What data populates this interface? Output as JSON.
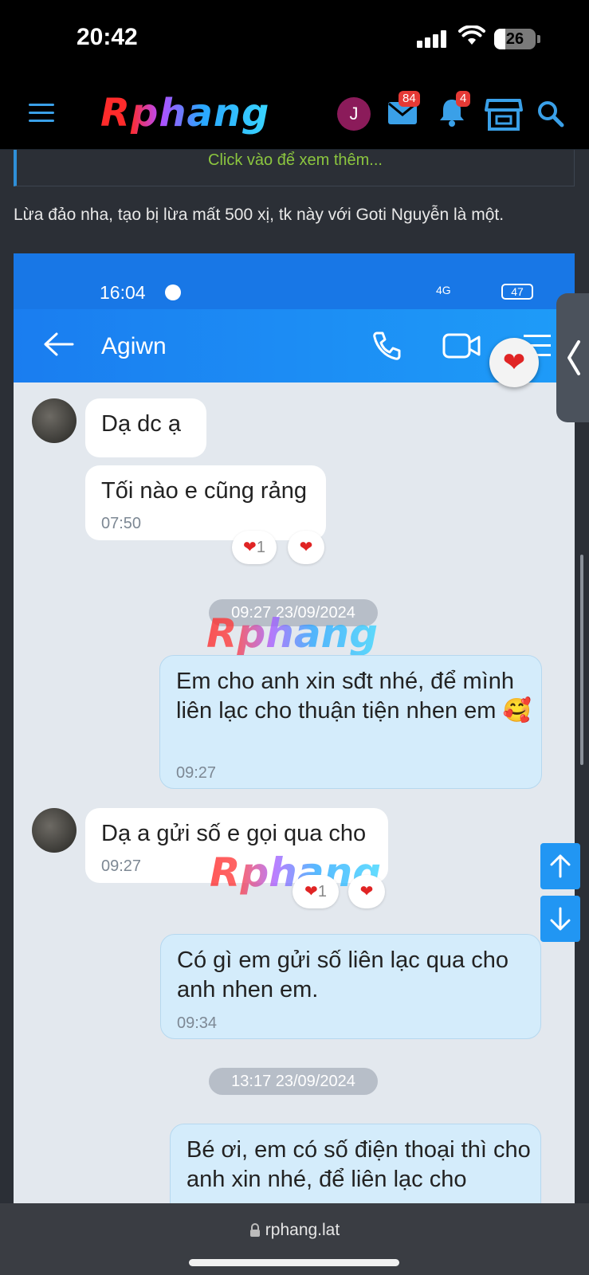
{
  "status_bar": {
    "time": "20:42",
    "battery": "26"
  },
  "header": {
    "logo": "Rphang",
    "avatar_initial": "J",
    "inbox_badge": "84",
    "alerts_badge": "4",
    "icons": [
      "menu-icon",
      "mail-icon",
      "bell-icon",
      "store-icon",
      "search-icon"
    ],
    "accent_color": "#3aa0e8"
  },
  "post": {
    "quote_expand": "Click vào để xem thêm...",
    "text": "Lừa đảo nha, tạo bị lừa mất 500 xị, tk này với Goti Nguyễn là một."
  },
  "screenshot": {
    "status_time": "16:04",
    "status_battery": "47",
    "status_network": "4G",
    "contact_name": "Agiwn",
    "watermark": "Rphang",
    "messages": [
      {
        "dir": "in",
        "text": "Dạ dc ạ",
        "time": ""
      },
      {
        "dir": "in",
        "text": "Tối nào e cũng rảng",
        "time": "07:50",
        "reaction_count": "1"
      },
      {
        "dir": "date",
        "text": "09:27 23/09/2024"
      },
      {
        "dir": "out",
        "text": "Em cho anh xin sđt nhé, để mình liên lạc cho thuận tiện nhen em 🥰",
        "time": "09:27"
      },
      {
        "dir": "in",
        "text": "Dạ a gửi số e gọi qua cho",
        "time": "09:27",
        "reaction_count": "1"
      },
      {
        "dir": "out",
        "text": "Có gì em gửi số liên lạc qua cho anh nhen em.",
        "time": "09:34"
      },
      {
        "dir": "date",
        "text": "13:17 23/09/2024"
      },
      {
        "dir": "out",
        "text": "Bé ơi, em có số điện thoại thì cho anh xin nhé, để liên lạc cho",
        "time": ""
      }
    ]
  },
  "browser": {
    "url": "rphang.lat"
  }
}
